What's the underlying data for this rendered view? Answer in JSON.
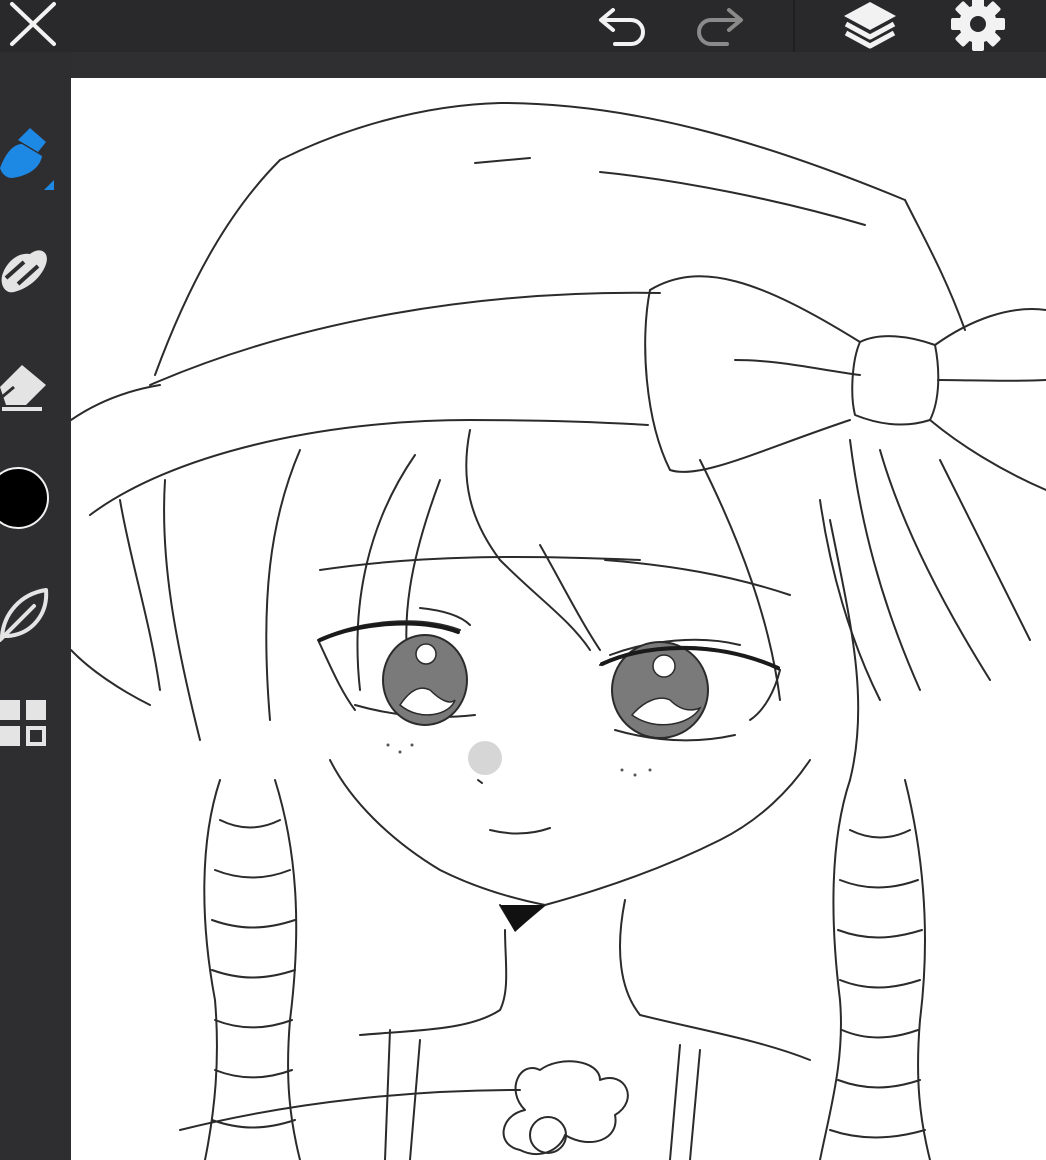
{
  "app": {
    "accent_color": "#1e88e5",
    "toolbar_bg": "#29292b",
    "sidebar_bg": "#2e2e30",
    "canvas_bg": "#ffffff",
    "icon_color": "#f2f2f2",
    "disabled_icon_color": "#8a8a8a"
  },
  "top_toolbar": {
    "close_icon": "close-icon",
    "undo_icon": "undo-icon",
    "redo_icon": "redo-icon",
    "redo_enabled": false,
    "layers_icon": "layers-icon",
    "settings_icon": "gear-icon"
  },
  "tools": [
    {
      "icon": "brush-icon",
      "active": true
    },
    {
      "icon": "smudge-icon",
      "active": false
    },
    {
      "icon": "eraser-icon",
      "active": false
    },
    {
      "icon": "color-swatch",
      "color": "#000000"
    },
    {
      "icon": "leaf-icon",
      "active": false
    },
    {
      "icon": "grid-icon",
      "active": false
    }
  ]
}
